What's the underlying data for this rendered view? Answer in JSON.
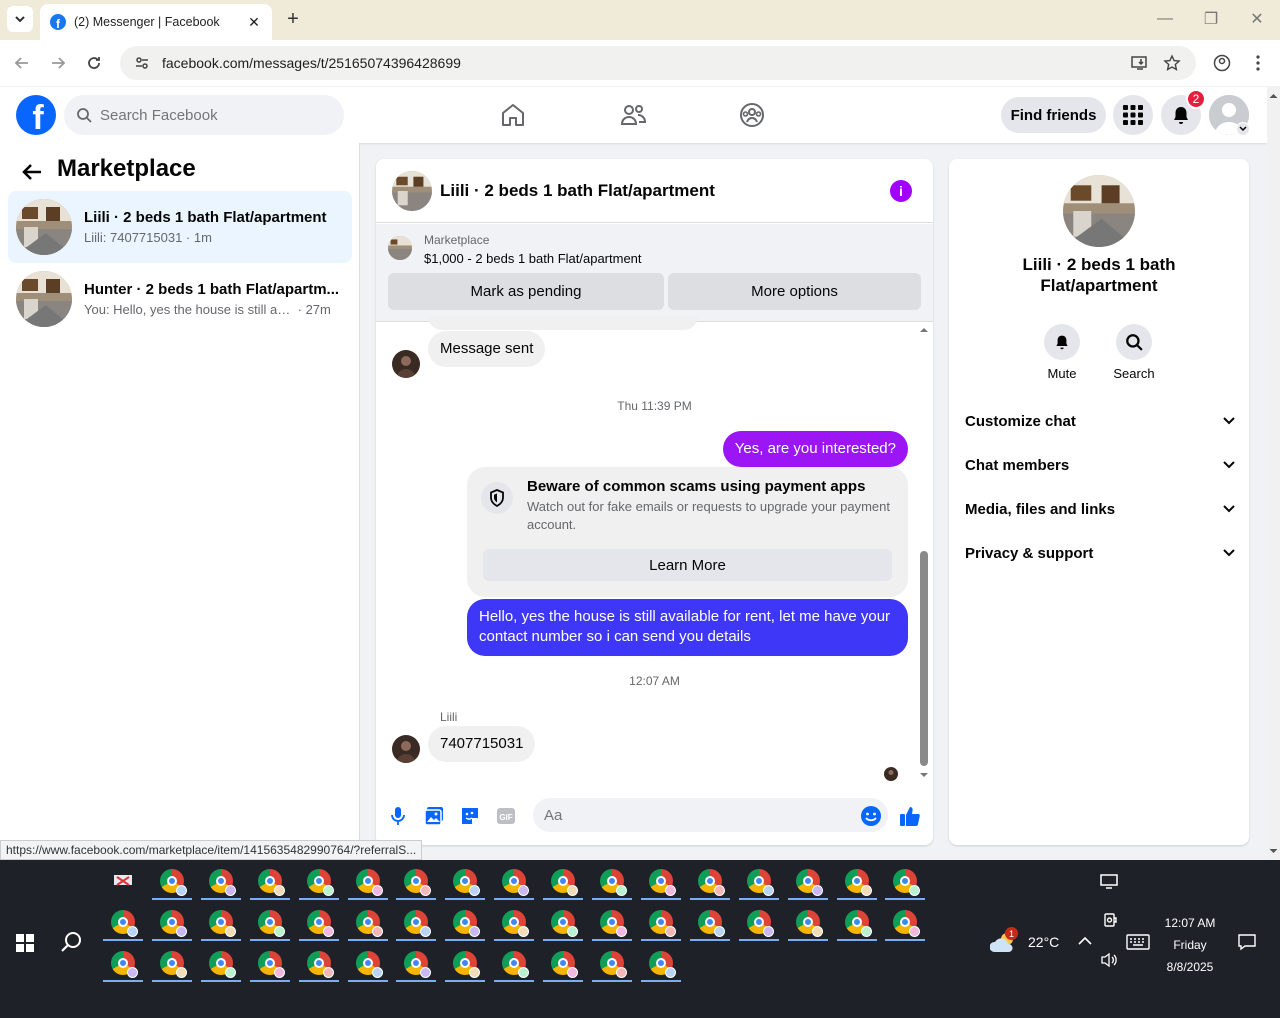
{
  "browser": {
    "tab_title": "(2) Messenger | Facebook",
    "url": "facebook.com/messages/t/25165074396428699",
    "status_url": "https://www.facebook.com/marketplace/item/1415635482990764/?referralS..."
  },
  "fb_header": {
    "search_placeholder": "Search Facebook",
    "find_friends_label": "Find friends",
    "notification_count": "2"
  },
  "left_panel": {
    "title": "Marketplace",
    "conversations": [
      {
        "title": "Liili · 2 beds 1 bath Flat/apartment",
        "preview": "Liili: 7407715031",
        "time": "1m",
        "active": true
      },
      {
        "title": "Hunter · 2 beds 1 bath Flat/apartm...",
        "preview": "You: Hello, yes the house is still avail...",
        "time": "27m",
        "active": false
      }
    ]
  },
  "chat": {
    "title": "Liili · 2 beds 1 bath Flat/apartment",
    "marketplace_label": "Marketplace",
    "listing": "$1,000 - 2 beds 1 bath Flat/apartment",
    "mark_pending_label": "Mark as pending",
    "more_options_label": "More options",
    "messages": {
      "msg_sent": "Message sent",
      "time1": "Thu 11:39 PM",
      "out1": "Yes, are you interested?",
      "scam_title": "Beware of common scams using payment apps",
      "scam_body": "Watch out for fake emails or requests to upgrade your payment account.",
      "learn_more": "Learn More",
      "out2": "Hello, yes the house is still available for rent, let me have your contact number so i can send you details",
      "time2": "12:07 AM",
      "sender_name": "Liili",
      "in2": "7407715031"
    },
    "composer_placeholder": "Aa"
  },
  "right_panel": {
    "name": "Liili · 2 beds 1 bath Flat/apartment",
    "mute_label": "Mute",
    "search_label": "Search",
    "sections": [
      "Customize chat",
      "Chat members",
      "Media, files and links",
      "Privacy & support"
    ]
  },
  "taskbar": {
    "temperature": "22°C",
    "weather_badge": "1",
    "time": "12:07 AM",
    "day": "Friday",
    "date": "8/8/2025"
  },
  "colors": {
    "fb_blue": "#0866ff",
    "outgoing_purple": "#9b15f5",
    "outgoing_blue": "#3e37f7",
    "active_conv": "#ebf5ff"
  }
}
